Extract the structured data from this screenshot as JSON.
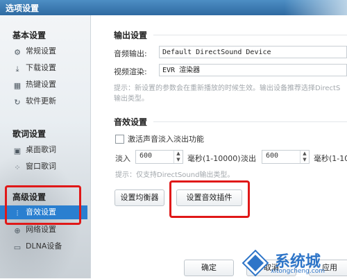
{
  "window": {
    "title": "选项设置"
  },
  "sidebar": {
    "sections": [
      {
        "title": "基本设置",
        "items": [
          {
            "label": "常规设置",
            "icon": "gear-icon"
          },
          {
            "label": "下载设置",
            "icon": "download-icon"
          },
          {
            "label": "热键设置",
            "icon": "keyboard-icon"
          },
          {
            "label": "软件更新",
            "icon": "update-icon"
          }
        ]
      },
      {
        "title": "歌词设置",
        "items": [
          {
            "label": "桌面歌词",
            "icon": "desktop-lyrics-icon"
          },
          {
            "label": "窗口歌词",
            "icon": "window-lyrics-icon"
          }
        ]
      },
      {
        "title": "高级设置",
        "items": [
          {
            "label": "音效设置",
            "icon": "equalizer-icon",
            "active": true
          },
          {
            "label": "网络设置",
            "icon": "network-icon"
          },
          {
            "label": "DLNA设备",
            "icon": "dlna-icon"
          }
        ]
      }
    ]
  },
  "output": {
    "title": "输出设置",
    "audio_label": "音频输出:",
    "audio_value": "Default DirectSound Device",
    "video_label": "视频渲染:",
    "video_value": "EVR 渲染器",
    "hint_line1": "提示：新设置的参数会在重新播放的时候生效。输出设备推荐选择DirectS",
    "hint_line2": "输出类型。"
  },
  "effects": {
    "title": "音效设置",
    "fade_checkbox_label": "激活声音淡入淡出功能",
    "fade_in_label": "淡入",
    "fade_in_value": "600",
    "fade_in_unit": "毫秒(1-10000)",
    "fade_out_label": "淡出",
    "fade_out_value": "600",
    "fade_out_unit": "毫秒(1-10",
    "hint": "提示：仅支持DirectSound输出类型。",
    "eq_button": "设置均衡器",
    "plugin_button": "设置音效插件"
  },
  "footer": {
    "ok_button": "确定",
    "cancel_button": "取消",
    "apply_button": "应用"
  },
  "watermark": {
    "main": "系统城",
    "sub": "xitongcheng.com"
  },
  "colors": {
    "highlight": "#e01818",
    "active_nav": "#2a7fd0",
    "titlebar": "#2f6aa1"
  }
}
